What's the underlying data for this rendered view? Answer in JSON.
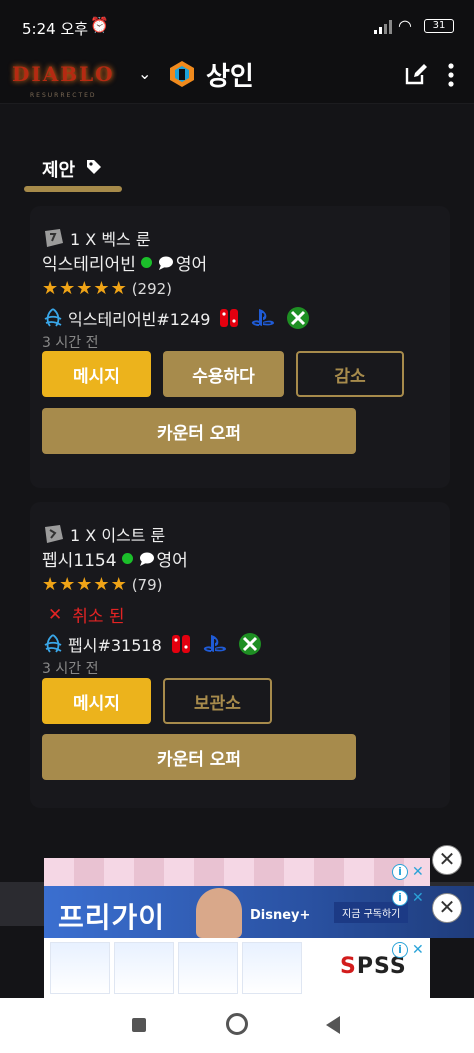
{
  "status": {
    "time": "5:24 오후",
    "battery": "31"
  },
  "app": {
    "logo_text": "DIABLO",
    "logo_sub": "RESURRECTED",
    "title": "상인"
  },
  "tab": {
    "label": "제안"
  },
  "offers": [
    {
      "item": "1 X 벡스 룬",
      "seller": "익스테리어빈",
      "language": "영어",
      "rating_count": "(292)",
      "stars": 5,
      "battlenet": "익스테리어빈#1249",
      "time_ago": "3 시간 전",
      "buttons": {
        "message": "메시지",
        "accept": "수용하다",
        "decline": "감소",
        "counter": "카운터 오퍼"
      }
    },
    {
      "item": "1 X 이스트 룬",
      "seller": "펩시1154",
      "language": "영어",
      "rating_count": "(79)",
      "stars": 5,
      "status": "취소 된",
      "battlenet": "펩시#31518",
      "time_ago": "3 시간 전",
      "buttons": {
        "message": "메시지",
        "archive": "보관소",
        "counter": "카운터 오퍼"
      }
    }
  ],
  "ads": {
    "ad2_title": "프리가이",
    "ad2_brand": "Disney+",
    "ad2_cta": "지금 구독하기",
    "ad3_brand": "PSS",
    "ad3_brand_accent": "S"
  },
  "colors": {
    "accent_yellow": "#ecb31c",
    "accent_gold": "#a78b4c",
    "online": "#1bbf2a",
    "cancel_red": "#e32424",
    "star": "#f0a417"
  }
}
